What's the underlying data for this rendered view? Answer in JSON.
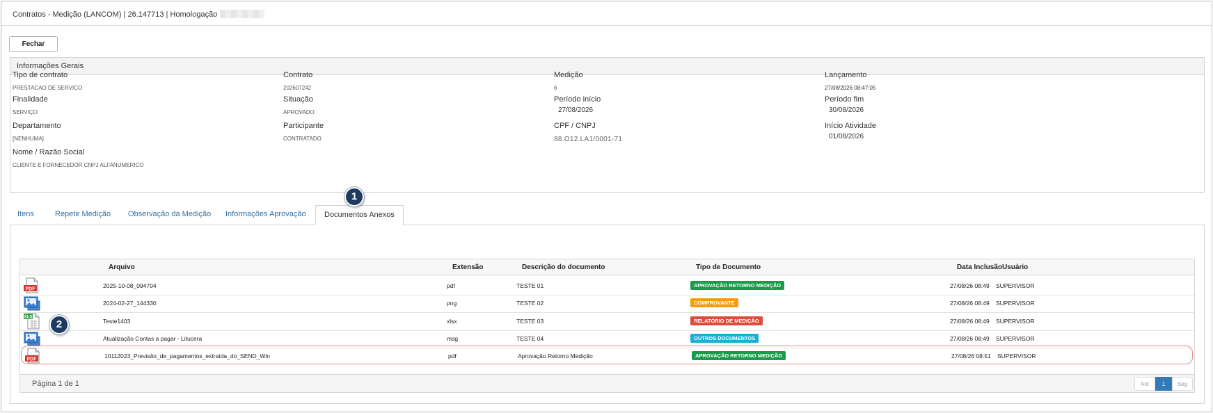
{
  "window": {
    "title": "Contratos - Medição (LANCOM) | 26.147713 | Homologação"
  },
  "toolbar": {
    "close_label": "Fechar"
  },
  "info": {
    "heading": "Informações Gerais",
    "tipo_contrato": {
      "label": "Tipo de contrato",
      "value": "PRESTACAO DE SERVICO"
    },
    "contrato": {
      "label": "Contrato",
      "value": "202607242"
    },
    "medicao": {
      "label": "Medição",
      "value": "6"
    },
    "lancamento": {
      "label": "Lançamento",
      "value": "27/08/2026 08:47:05"
    },
    "finalidade": {
      "label": "Finalidade",
      "value": "SERVIÇO"
    },
    "situacao": {
      "label": "Situação",
      "value": "APROVADO"
    },
    "periodo_inicio": {
      "label": "Período início",
      "value": "27/08/2026"
    },
    "periodo_fim": {
      "label": "Período fim",
      "value": "30/08/2026"
    },
    "departamento": {
      "label": "Departamento",
      "value": "[NENHUMA]"
    },
    "participante": {
      "label": "Participante",
      "value": "CONTRATADO"
    },
    "cpf_cnpj": {
      "label": "CPF / CNPJ",
      "value": "88.O12.LA1/0001-71"
    },
    "inicio_atividade": {
      "label": "Início Atividade",
      "value": "01/08/2026"
    },
    "nome": {
      "label": "Nome / Razão Social",
      "value": "CLIENTE E FORNECEDOR CNPJ ALFANUMERICO"
    }
  },
  "tabs": [
    {
      "label": "Itens"
    },
    {
      "label": "Repetir Medição"
    },
    {
      "label": "Observação da Medição"
    },
    {
      "label": "Informações Aprovação"
    },
    {
      "label": "Documentos Anexos",
      "active": true
    }
  ],
  "markers": {
    "one": "1",
    "two": "2"
  },
  "grid": {
    "headers": {
      "arquivo": "Arquivo",
      "extensao": "Extensão",
      "descricao": "Descrição do documento",
      "tipo": "Tipo de Documento",
      "data": "Data Inclusão",
      "usuario": "Usuário"
    },
    "rows": [
      {
        "icon": "pdf-file-icon",
        "arquivo": "2025-10-08_094704",
        "extensao": "pdf",
        "descricao": "TESTE 01",
        "tipo": "APROVAÇÃO RETORNO MEDIÇÃO",
        "tipo_color": "#1a9b4b",
        "data": "27/08/26 08:49",
        "usuario": "SUPERVISOR"
      },
      {
        "icon": "image-file-icon",
        "arquivo": "2024-02-27_144330",
        "extensao": "png",
        "descricao": "TESTE 02",
        "tipo": "COMPROVANTE",
        "tipo_color": "#f39c12",
        "data": "27/08/26 08:49",
        "usuario": "SUPERVISOR"
      },
      {
        "icon": "xls-file-icon",
        "arquivo": "Teste1403",
        "extensao": "xlsx",
        "descricao": "TESTE 03",
        "tipo": "RELATÓRIO DE MEDIÇÃO",
        "tipo_color": "#dd4b39",
        "data": "27/08/26 08:49",
        "usuario": "SUPERVISOR"
      },
      {
        "icon": "image-file-icon",
        "arquivo": "Atualização Contas a pagar - Litucera",
        "extensao": "msg",
        "descricao": "TESTE 04",
        "tipo": "OUTROS DOCUMENTOS",
        "tipo_color": "#17b1d6",
        "data": "27/08/26 08:49",
        "usuario": "SUPERVISOR"
      },
      {
        "icon": "pdf-file-icon",
        "arquivo": "10112023_Previsão_de_pagamentos_extraída_do_SEND_Win",
        "extensao": "pdf",
        "descricao": "Aprovação Retorno Medição",
        "tipo": "APROVAÇÃO RETORNO MEDIÇÃO",
        "tipo_color": "#1a9b4b",
        "data": "27/08/26 08:51",
        "usuario": "SUPERVISOR",
        "highlight": true
      }
    ],
    "page_info": "Página 1 de 1",
    "pager": {
      "prev": "Ant",
      "current": "1",
      "next": "Seg"
    }
  }
}
